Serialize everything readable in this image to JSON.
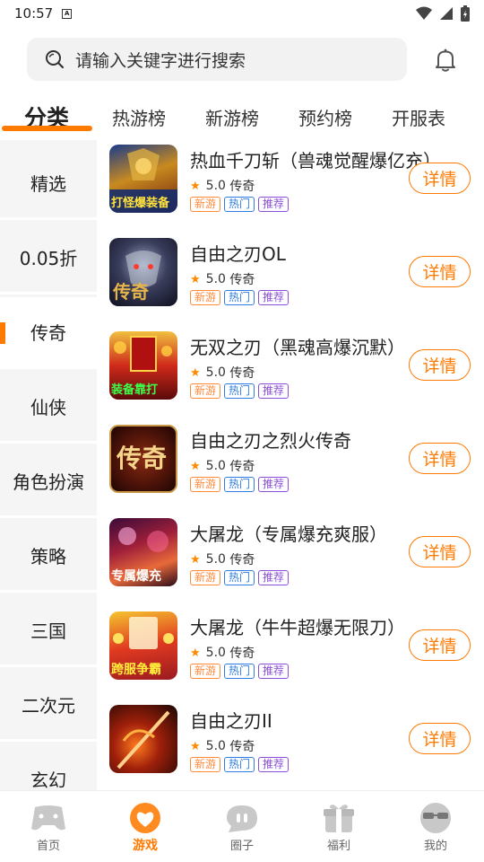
{
  "status_bar": {
    "time": "10:57",
    "notify_icon": "A"
  },
  "search": {
    "placeholder": "请输入关键字进行搜索"
  },
  "tabs": [
    {
      "label": "分类",
      "active": true
    },
    {
      "label": "热游榜"
    },
    {
      "label": "新游榜"
    },
    {
      "label": "预约榜"
    },
    {
      "label": "开服表"
    }
  ],
  "categories": [
    {
      "label": "精选"
    },
    {
      "label": "0.05折"
    },
    {
      "label": "传奇",
      "active": true
    },
    {
      "label": "仙侠"
    },
    {
      "label": "角色扮演"
    },
    {
      "label": "策略"
    },
    {
      "label": "三国"
    },
    {
      "label": "二次元"
    },
    {
      "label": "玄幻"
    }
  ],
  "games": [
    {
      "name": "热血千刀斩（兽魂觉醒爆亿充）",
      "rating": "5.0",
      "genre": "传奇",
      "cover_text": "打怪爆装备"
    },
    {
      "name": "自由之刃OL",
      "rating": "5.0",
      "genre": "传奇",
      "cover_text": "传奇"
    },
    {
      "name": "无双之刃（黑魂高爆沉默）",
      "rating": "5.0",
      "genre": "传奇",
      "cover_text": "装备靠打"
    },
    {
      "name": "自由之刃之烈火传奇",
      "rating": "5.0",
      "genre": "传奇",
      "cover_text": "传奇"
    },
    {
      "name": "大屠龙（专属爆充爽服）",
      "rating": "5.0",
      "genre": "传奇",
      "cover_text": "专属爆充"
    },
    {
      "name": "大屠龙（牛牛超爆无限刀）",
      "rating": "5.0",
      "genre": "传奇",
      "cover_text": "跨服争霸"
    },
    {
      "name": "自由之刃II",
      "rating": "5.0",
      "genre": "传奇",
      "cover_text": ""
    }
  ],
  "badges": {
    "new": "新游",
    "hot": "热门",
    "rec": "推荐"
  },
  "detail_label": "详情",
  "nav": [
    {
      "label": "首页",
      "icon": "gamepad-icon"
    },
    {
      "label": "游戏",
      "icon": "heart-chat-icon",
      "active": true
    },
    {
      "label": "圈子",
      "icon": "chat-bubble-icon"
    },
    {
      "label": "福利",
      "icon": "gift-icon"
    },
    {
      "label": "我的",
      "icon": "face-sunglasses-icon"
    }
  ],
  "colors": {
    "accent": "#ff7a00",
    "badge_new": "#ff8a3c",
    "badge_hot": "#2f7de1",
    "badge_rec": "#8b4fd8"
  }
}
